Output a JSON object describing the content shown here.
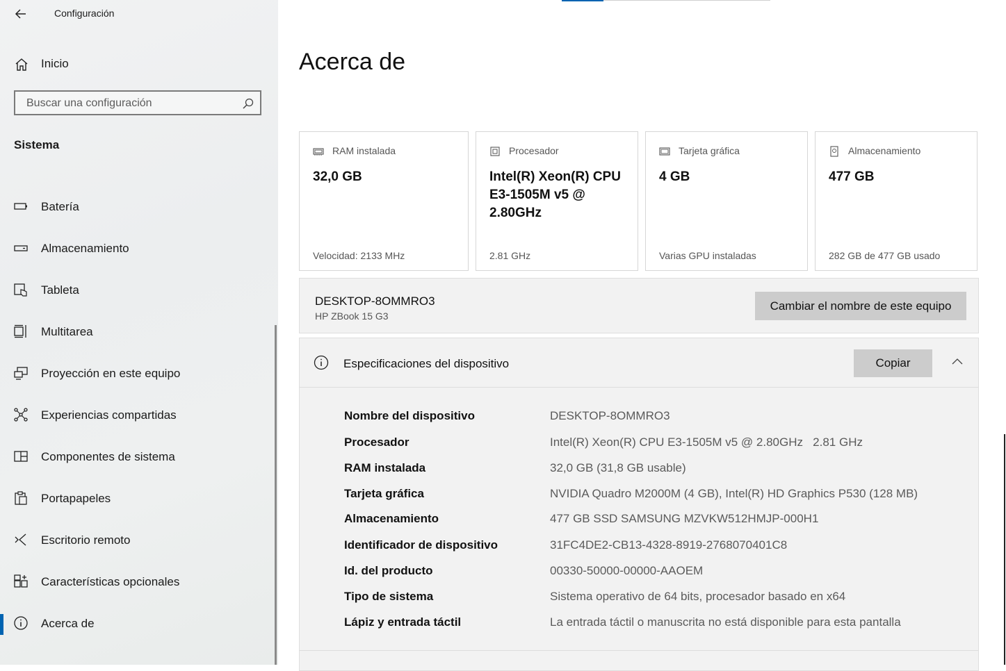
{
  "window": {
    "title": "Configuración"
  },
  "home": {
    "label": "Inicio"
  },
  "search": {
    "placeholder": "Buscar una configuración"
  },
  "section": {
    "title": "Sistema"
  },
  "nav": [
    {
      "label": "Batería",
      "icon": "battery-icon"
    },
    {
      "label": "Almacenamiento",
      "icon": "storage-icon"
    },
    {
      "label": "Tableta",
      "icon": "tablet-icon"
    },
    {
      "label": "Multitarea",
      "icon": "multitask-icon"
    },
    {
      "label": "Proyección en este equipo",
      "icon": "projection-icon"
    },
    {
      "label": "Experiencias compartidas",
      "icon": "shared-icon"
    },
    {
      "label": "Componentes de sistema",
      "icon": "components-icon"
    },
    {
      "label": "Portapapeles",
      "icon": "clipboard-icon"
    },
    {
      "label": "Escritorio remoto",
      "icon": "remote-desktop-icon"
    },
    {
      "label": "Características opcionales",
      "icon": "optional-features-icon"
    },
    {
      "label": "Acerca de",
      "icon": "info-icon",
      "active": true
    }
  ],
  "page": {
    "title": "Acerca de"
  },
  "cards": [
    {
      "label": "RAM instalada",
      "value": "32,0 GB",
      "sub": "Velocidad: 2133 MHz",
      "icon": "ram-icon"
    },
    {
      "label": "Procesador",
      "value": "Intel(R) Xeon(R) CPU E3-1505M v5 @ 2.80GHz",
      "sub": "2.81 GHz",
      "icon": "cpu-icon"
    },
    {
      "label": "Tarjeta gráfica",
      "value": "4 GB",
      "sub": "Varias GPU instaladas",
      "icon": "gpu-icon"
    },
    {
      "label": "Almacenamiento",
      "value": "477 GB",
      "sub": "282 GB de 477 GB usado",
      "icon": "drive-icon"
    }
  ],
  "device": {
    "name": "DESKTOP-8OMMRO3",
    "model": "HP ZBook 15 G3",
    "rename_label": "Cambiar el nombre de este equipo"
  },
  "specs": {
    "title": "Especificaciones del dispositivo",
    "copy_label": "Copiar",
    "rows": [
      {
        "key": "Nombre del dispositivo",
        "value": "DESKTOP-8OMMRO3"
      },
      {
        "key": "Procesador",
        "value": "Intel(R) Xeon(R) CPU E3-1505M v5 @ 2.80GHz   2.81 GHz"
      },
      {
        "key": "RAM instalada",
        "value": "32,0 GB (31,8 GB usable)"
      },
      {
        "key": "Tarjeta gráfica",
        "value": "NVIDIA Quadro M2000M (4 GB), Intel(R) HD Graphics P530 (128 MB)"
      },
      {
        "key": "Almacenamiento",
        "value": "477 GB SSD SAMSUNG MZVKW512HMJP-000H1"
      },
      {
        "key": "Identificador de dispositivo",
        "value": "31FC4DE2-CB13-4328-8919-2768070401C8"
      },
      {
        "key": "Id. del producto",
        "value": "00330-50000-00000-AAOEM"
      },
      {
        "key": "Tipo de sistema",
        "value": "Sistema operativo de 64 bits, procesador basado en x64"
      },
      {
        "key": "Lápiz y entrada táctil",
        "value": "La entrada táctil o manuscrita no está disponible para esta pantalla"
      }
    ]
  },
  "colors": {
    "accent": "#0063b1",
    "button_bg": "#cccccc",
    "panel_bg": "#f2f2f2"
  }
}
